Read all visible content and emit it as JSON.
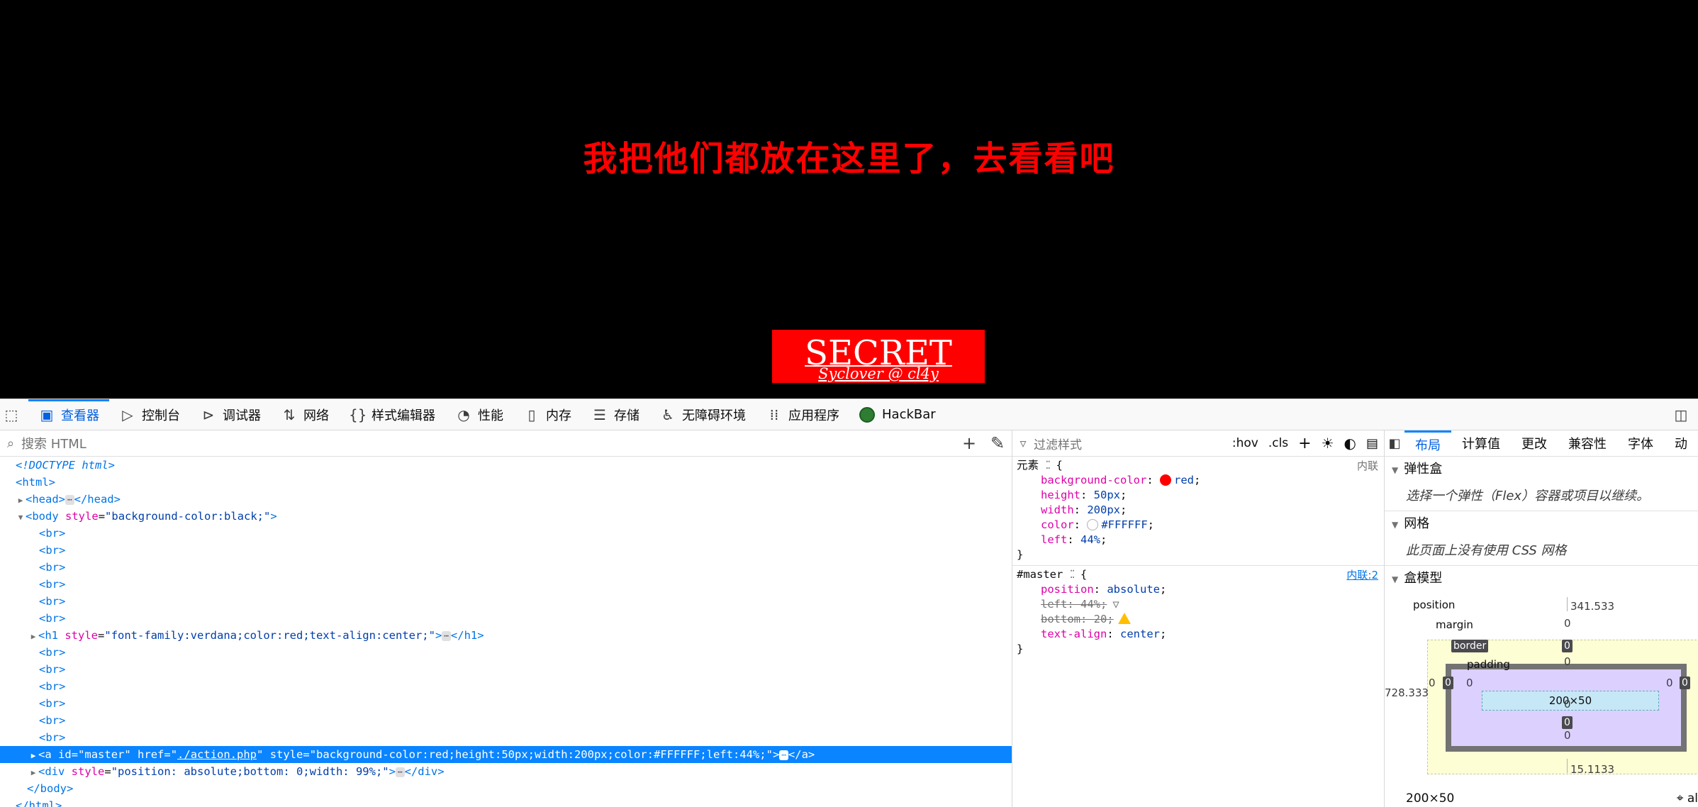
{
  "viewport": {
    "heading": "我把他们都放在这里了，去看看吧",
    "secret_title": "SECRET",
    "secret_subtitle": "Syclover @ cl4y",
    "heading_color": "#ff0000",
    "button_color": "#ff0000"
  },
  "toolbar": {
    "items": [
      {
        "label": "查看器",
        "icon": "inspector-icon",
        "active": true
      },
      {
        "label": "控制台",
        "icon": "console-icon"
      },
      {
        "label": "调试器",
        "icon": "debugger-icon"
      },
      {
        "label": "网络",
        "icon": "network-icon"
      },
      {
        "label": "样式编辑器",
        "icon": "style-editor-icon"
      },
      {
        "label": "性能",
        "icon": "performance-icon"
      },
      {
        "label": "内存",
        "icon": "memory-icon"
      },
      {
        "label": "存储",
        "icon": "storage-icon"
      },
      {
        "label": "无障碍环境",
        "icon": "accessibility-icon"
      },
      {
        "label": "应用程序",
        "icon": "application-icon"
      },
      {
        "label": "HackBar",
        "icon": "hackbar-icon"
      }
    ]
  },
  "markup": {
    "search_placeholder": "搜索 HTML",
    "doctype": "<!DOCTYPE html>",
    "html_open": "<html>",
    "head_open": "<head>",
    "head_close": "</head>",
    "body_open": "<body",
    "body_attr_name": "style",
    "body_attr_value": "\"background-color:black;\"",
    "br": "<br>",
    "h1_open": "<h1",
    "h1_attr_name": "style",
    "h1_attr_value": "\"font-family:verdana;color:red;text-align:center;\"",
    "h1_close": "</h1>",
    "a_open": "<a",
    "a_id_name": "id",
    "a_id_value": "\"master\"",
    "a_href_name": "href",
    "a_href_value": "./action.php",
    "a_style_name": "style",
    "a_style_value": "\"background-color:red;height:50px;width:200px;color:#FFFFFF;left:44%;\"",
    "a_close": "</a>",
    "div_open": "<div",
    "div_attr_name": "style",
    "div_attr_value": "\"position: absolute;bottom: 0;width: 99%;\"",
    "div_close": "</div>",
    "body_close": "</body>",
    "html_close": "</html>",
    "ellipsis": "⋯"
  },
  "rules": {
    "filter_placeholder": "过滤样式",
    "hov": ":hov",
    "cls": ".cls",
    "element_rule": {
      "selector": "元素",
      "source": "内联",
      "decls": [
        {
          "prop": "background-color",
          "value": "red",
          "swatch": "#ff0000"
        },
        {
          "prop": "height",
          "value": "50px"
        },
        {
          "prop": "width",
          "value": "200px"
        },
        {
          "prop": "color",
          "value": "#FFFFFF",
          "swatch": "#ffffff"
        },
        {
          "prop": "left",
          "value": "44%"
        }
      ]
    },
    "master_rule": {
      "selector": "#master",
      "source": "内联:2",
      "decls": [
        {
          "prop": "position",
          "value": "absolute"
        },
        {
          "prop": "left",
          "value": "44%",
          "struck": true
        },
        {
          "prop": "bottom",
          "value": "20",
          "struck": true
        },
        {
          "prop": "text-align",
          "value": "center"
        }
      ]
    }
  },
  "sidebar": {
    "tabs": [
      "布局",
      "计算值",
      "更改",
      "兼容性",
      "字体",
      "动"
    ],
    "flex_section": "弹性盒",
    "flex_note": "选择一个弹性（Flex）容器或项目以继续。",
    "grid_section": "网格",
    "grid_note": "此页面上没有使用 CSS 网格",
    "boxmodel_section": "盒模型",
    "boxmodel": {
      "position_label": "position",
      "top": "341.533",
      "left": "728.333",
      "bottom": "15.1133",
      "margin_label": "margin",
      "border_label": "border",
      "padding_label": "padding",
      "margin_top": "0",
      "margin_bottom": "0",
      "margin_left": "0",
      "margin_right": "0",
      "border_top": "0",
      "border_bottom": "0",
      "border_left": "0",
      "border_right": "0",
      "padding_top": "0",
      "padding_bottom": "0",
      "padding_left": "0",
      "padding_right": "0",
      "content": "200×50"
    },
    "footer_size": "200×50",
    "footer_cut": "al"
  }
}
